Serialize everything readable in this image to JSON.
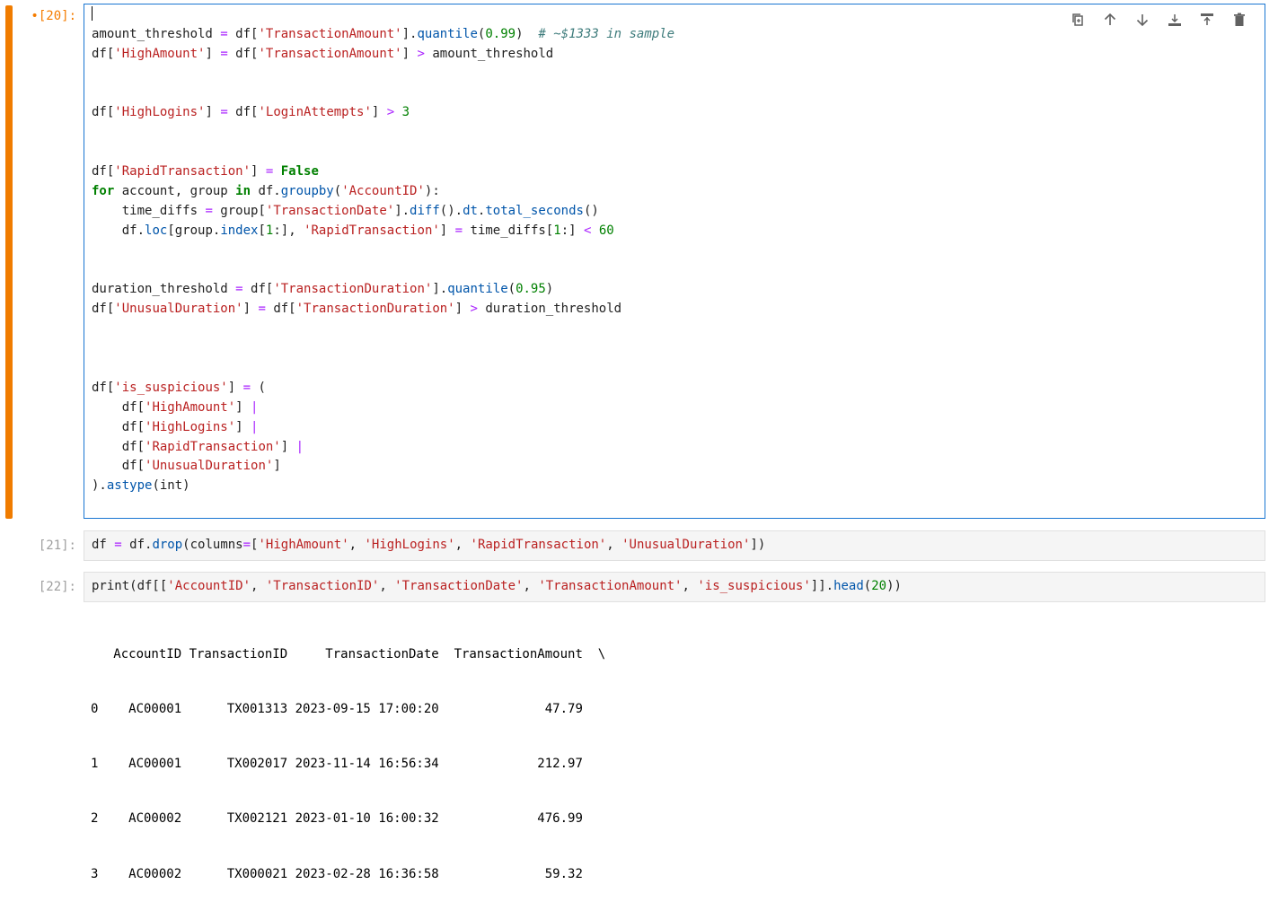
{
  "cells": [
    {
      "prompt": "•[20]:",
      "active": true,
      "code_lines": [
        [],
        [
          [
            "",
            "amount_threshold "
          ],
          [
            "op",
            "="
          ],
          [
            "",
            " df["
          ],
          [
            "str",
            "'TransactionAmount'"
          ],
          [
            "",
            "]."
          ],
          [
            "attr",
            "quantile"
          ],
          [
            "",
            "("
          ],
          [
            "num",
            "0.99"
          ],
          [
            "",
            ")  "
          ],
          [
            "cmt",
            "# ~$1333 in sample"
          ]
        ],
        [
          [
            "",
            "df["
          ],
          [
            "str",
            "'HighAmount'"
          ],
          [
            "",
            "] "
          ],
          [
            "op",
            "="
          ],
          [
            "",
            " df["
          ],
          [
            "str",
            "'TransactionAmount'"
          ],
          [
            "",
            "] "
          ],
          [
            "op",
            ">"
          ],
          [
            "",
            " amount_threshold"
          ]
        ],
        [],
        [],
        [
          [
            "",
            "df["
          ],
          [
            "str",
            "'HighLogins'"
          ],
          [
            "",
            "] "
          ],
          [
            "op",
            "="
          ],
          [
            "",
            " df["
          ],
          [
            "str",
            "'LoginAttempts'"
          ],
          [
            "",
            "] "
          ],
          [
            "op",
            ">"
          ],
          [
            "",
            " "
          ],
          [
            "num",
            "3"
          ]
        ],
        [],
        [],
        [
          [
            "",
            "df["
          ],
          [
            "str",
            "'RapidTransaction'"
          ],
          [
            "",
            "] "
          ],
          [
            "op",
            "="
          ],
          [
            "",
            " "
          ],
          [
            "kw",
            "False"
          ]
        ],
        [
          [
            "kw",
            "for"
          ],
          [
            "",
            " account, group "
          ],
          [
            "kw",
            "in"
          ],
          [
            "",
            " df."
          ],
          [
            "attr",
            "groupby"
          ],
          [
            "",
            "("
          ],
          [
            "str",
            "'AccountID'"
          ],
          [
            "",
            "):"
          ]
        ],
        [
          [
            "",
            "    time_diffs "
          ],
          [
            "op",
            "="
          ],
          [
            "",
            " group["
          ],
          [
            "str",
            "'TransactionDate'"
          ],
          [
            "",
            "]."
          ],
          [
            "attr",
            "diff"
          ],
          [
            "",
            "()."
          ],
          [
            "attr",
            "dt"
          ],
          [
            "",
            "."
          ],
          [
            "attr",
            "total_seconds"
          ],
          [
            "",
            "()"
          ]
        ],
        [
          [
            "",
            "    df."
          ],
          [
            "attr",
            "loc"
          ],
          [
            "",
            "[group."
          ],
          [
            "attr",
            "index"
          ],
          [
            "",
            "["
          ],
          [
            "num",
            "1"
          ],
          [
            "",
            ":], "
          ],
          [
            "str",
            "'RapidTransaction'"
          ],
          [
            "",
            "] "
          ],
          [
            "op",
            "="
          ],
          [
            "",
            " time_diffs["
          ],
          [
            "num",
            "1"
          ],
          [
            "",
            ":] "
          ],
          [
            "op",
            "<"
          ],
          [
            "",
            " "
          ],
          [
            "num",
            "60"
          ]
        ],
        [],
        [],
        [
          [
            "",
            "duration_threshold "
          ],
          [
            "op",
            "="
          ],
          [
            "",
            " df["
          ],
          [
            "str",
            "'TransactionDuration'"
          ],
          [
            "",
            "]."
          ],
          [
            "attr",
            "quantile"
          ],
          [
            "",
            "("
          ],
          [
            "num",
            "0.95"
          ],
          [
            "",
            ")"
          ]
        ],
        [
          [
            "",
            "df["
          ],
          [
            "str",
            "'UnusualDuration'"
          ],
          [
            "",
            "] "
          ],
          [
            "op",
            "="
          ],
          [
            "",
            " df["
          ],
          [
            "str",
            "'TransactionDuration'"
          ],
          [
            "",
            "] "
          ],
          [
            "op",
            ">"
          ],
          [
            "",
            " duration_threshold"
          ]
        ],
        [],
        [],
        [],
        [
          [
            "",
            "df["
          ],
          [
            "str",
            "'is_suspicious'"
          ],
          [
            "",
            "] "
          ],
          [
            "op",
            "="
          ],
          [
            "",
            " ("
          ]
        ],
        [
          [
            "",
            "    df["
          ],
          [
            "str",
            "'HighAmount'"
          ],
          [
            "",
            "] "
          ],
          [
            "op",
            "|"
          ]
        ],
        [
          [
            "",
            "    df["
          ],
          [
            "str",
            "'HighLogins'"
          ],
          [
            "",
            "] "
          ],
          [
            "op",
            "|"
          ]
        ],
        [
          [
            "",
            "    df["
          ],
          [
            "str",
            "'RapidTransaction'"
          ],
          [
            "",
            "] "
          ],
          [
            "op",
            "|"
          ]
        ],
        [
          [
            "",
            "    df["
          ],
          [
            "str",
            "'UnusualDuration'"
          ],
          [
            "",
            "]"
          ]
        ],
        [
          [
            "",
            ")."
          ],
          [
            "attr",
            "astype"
          ],
          [
            "",
            "(int)"
          ]
        ]
      ]
    },
    {
      "prompt": "[21]:",
      "active": false,
      "code_lines": [
        [
          [
            "",
            "df "
          ],
          [
            "op",
            "="
          ],
          [
            "",
            " df."
          ],
          [
            "attr",
            "drop"
          ],
          [
            "",
            "(columns"
          ],
          [
            "op",
            "="
          ],
          [
            "",
            "["
          ],
          [
            "str",
            "'HighAmount'"
          ],
          [
            "",
            ", "
          ],
          [
            "str",
            "'HighLogins'"
          ],
          [
            "",
            ", "
          ],
          [
            "str",
            "'RapidTransaction'"
          ],
          [
            "",
            ", "
          ],
          [
            "str",
            "'UnusualDuration'"
          ],
          [
            "",
            "])"
          ]
        ]
      ]
    },
    {
      "prompt": "[22]:",
      "active": false,
      "code_lines": [
        [
          [
            "",
            "print(df[["
          ],
          [
            "str",
            "'AccountID'"
          ],
          [
            "",
            ", "
          ],
          [
            "str",
            "'TransactionID'"
          ],
          [
            "",
            ", "
          ],
          [
            "str",
            "'TransactionDate'"
          ],
          [
            "",
            ", "
          ],
          [
            "str",
            "'TransactionAmount'"
          ],
          [
            "",
            ", "
          ],
          [
            "str",
            "'is_suspicious'"
          ],
          [
            "",
            "]]."
          ],
          [
            "attr",
            "head"
          ],
          [
            "",
            "("
          ],
          [
            "num",
            "20"
          ],
          [
            "",
            "))"
          ]
        ]
      ]
    }
  ],
  "toolbar": {
    "icons": [
      "duplicate-icon",
      "move-up-icon",
      "move-down-icon",
      "insert-above-icon",
      "insert-below-icon",
      "delete-icon"
    ]
  },
  "output_lines": [
    "   AccountID TransactionID     TransactionDate  TransactionAmount  \\",
    "0    AC00001      TX001313 2023-09-15 17:00:20              47.79",
    "1    AC00001      TX002017 2023-11-14 16:56:34             212.97",
    "2    AC00002      TX002121 2023-01-10 16:00:32             476.99",
    "3    AC00002      TX000021 2023-02-28 16:36:58              59.32"
  ]
}
